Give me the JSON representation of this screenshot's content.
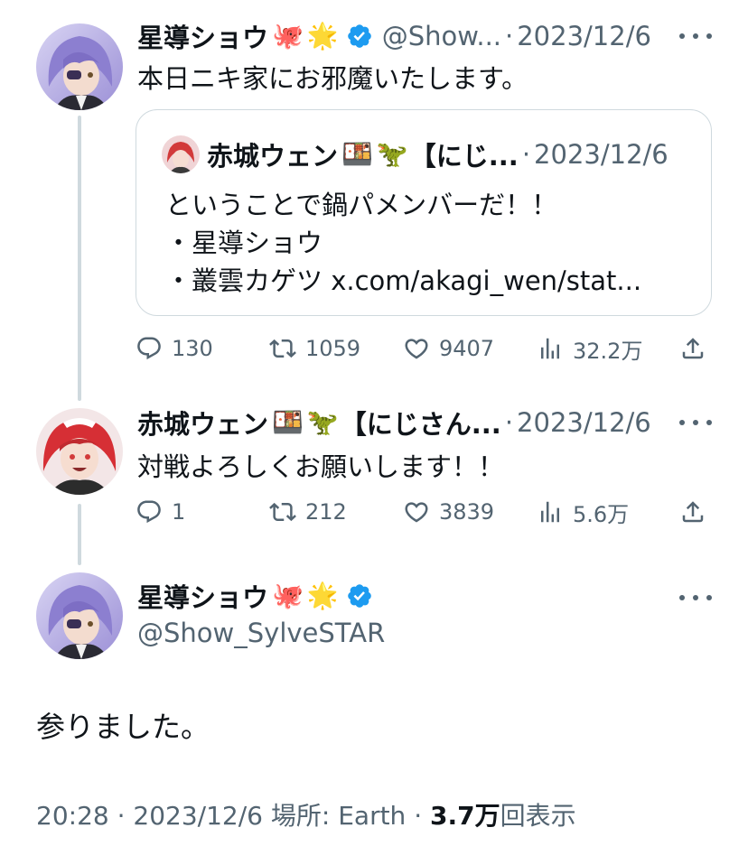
{
  "tweet1": {
    "author_name": "星導ショウ",
    "emojis": [
      "🐙",
      "🌟"
    ],
    "handle": "@Show...",
    "separator": "·",
    "date": "2023/12/6",
    "text": "本日ニキ家にお邪魔いたします。",
    "quote": {
      "author_name": "赤城ウェン",
      "emojis": [
        "🍱",
        "🦖"
      ],
      "name_suffix": "【にじ...",
      "separator": "·",
      "date": "2023/12/6",
      "lines": [
        "ということで鍋パメンバーだ！！",
        "・星導ショウ",
        "・叢雲カゲツ x.com/akagi_wen/stat..."
      ]
    },
    "stats": {
      "replies": "130",
      "retweets": "1059",
      "likes": "9407",
      "views": "32.2万"
    }
  },
  "tweet2": {
    "author_name": "赤城ウェン",
    "emojis": [
      "🍱",
      "🦖"
    ],
    "name_suffix": "【にじさん...",
    "separator": "·",
    "date": "2023/12/6",
    "text": "対戦よろしくお願いします！！",
    "stats": {
      "replies": "1",
      "retweets": "212",
      "likes": "3839",
      "views": "5.6万"
    }
  },
  "main_tweet": {
    "author_name": "星導ショウ",
    "emojis": [
      "🐙",
      "🌟"
    ],
    "handle": "@Show_SylveSTAR",
    "text": "参りました。",
    "meta": {
      "time": "20:28",
      "sep1": " · ",
      "date": "2023/12/6",
      "location": " 場所: Earth",
      "sep2": " · ",
      "views": "3.7万",
      "views_label": "回表示"
    }
  },
  "icons": {
    "reply": "reply-icon",
    "retweet": "retweet-icon",
    "like": "heart-icon",
    "views": "views-icon",
    "share": "share-icon",
    "verified": "verified-badge-icon",
    "more": "more-icon"
  },
  "colors": {
    "text": "#0f1419",
    "muted": "#536471",
    "verified": "#1d9bf0",
    "border": "#cfd9de"
  }
}
